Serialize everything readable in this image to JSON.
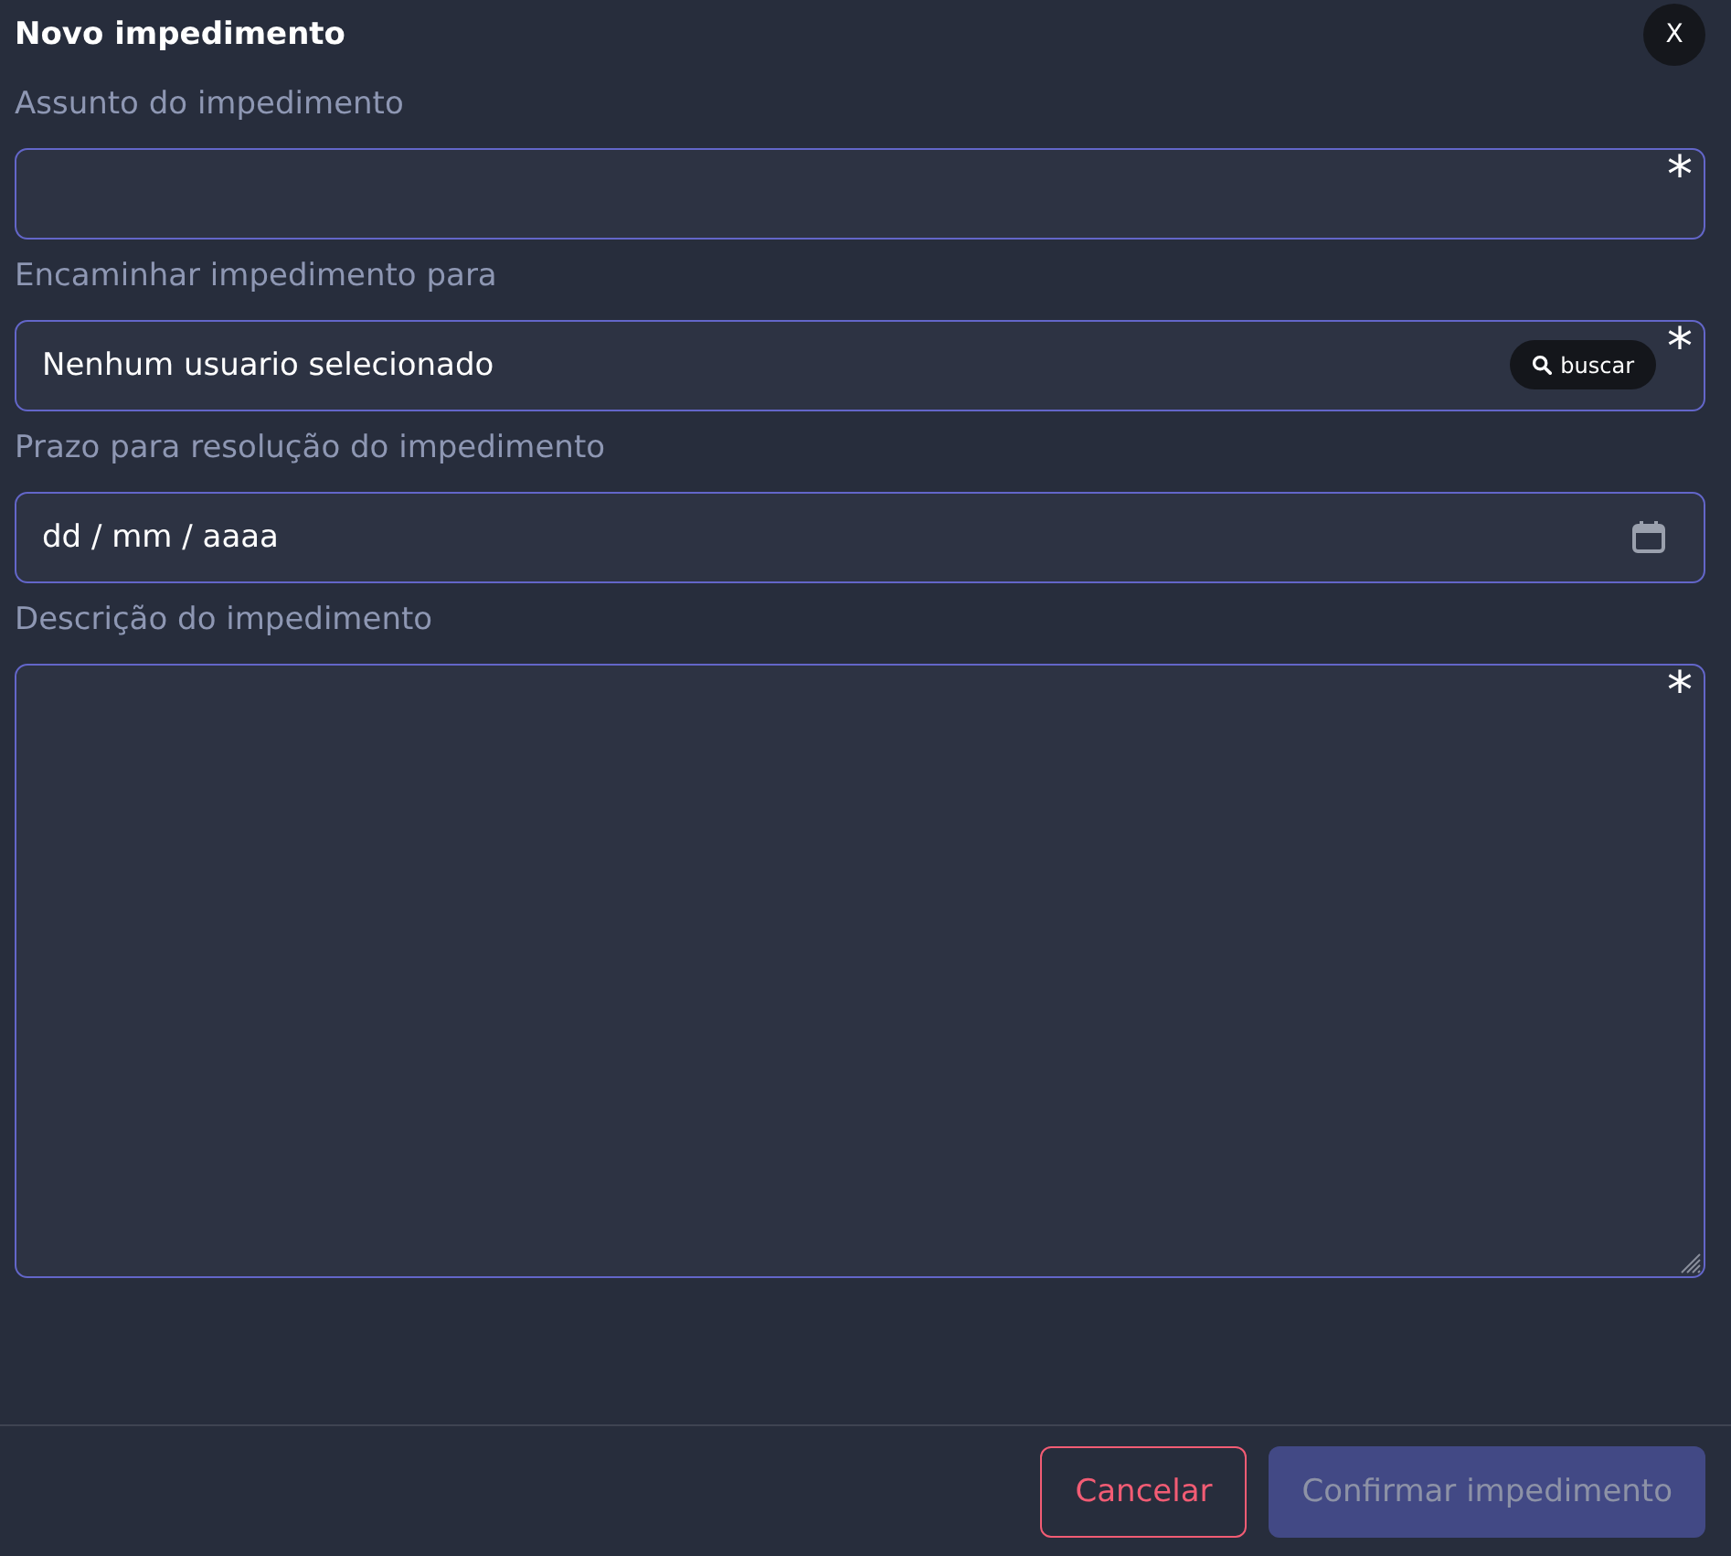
{
  "dialog": {
    "title": "Novo impedimento",
    "close": "X"
  },
  "fields": [
    {
      "kind": "text",
      "label": "Assunto do impedimento",
      "required": "*"
    },
    {
      "kind": "user",
      "label": "Encaminhar impedimento para",
      "value": "Nenhum usuario selecionado",
      "search_button": "buscar",
      "required": "*"
    },
    {
      "kind": "date",
      "label": "Prazo para resolução do impedimento",
      "placeholder": "dd / mm / aaaa"
    },
    {
      "kind": "textarea",
      "label": "Descrição do impedimento",
      "required": "*"
    }
  ],
  "buttons": [
    {
      "label": "Cancelar",
      "kind": "cancel",
      "disabled": false
    },
    {
      "label": "Confirmar impedimento",
      "kind": "confirm",
      "disabled": true
    }
  ]
}
